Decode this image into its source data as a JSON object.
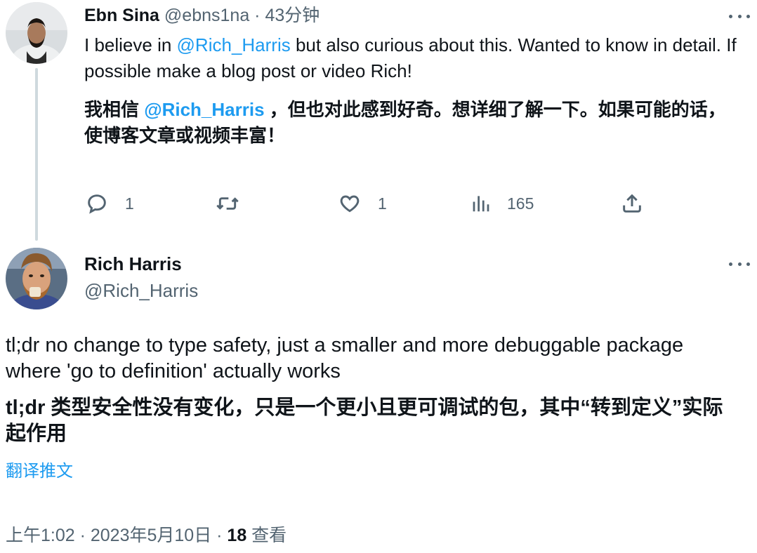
{
  "tweet1": {
    "author_name": "Ebn Sina",
    "handle": "@ebns1na",
    "separator": " · ",
    "time_ago": "43分钟",
    "text_before_mention": "I believe in ",
    "mention": "@Rich_Harris",
    "text_after_mention": " but also curious about this. Wanted to know in detail. If possible make a blog post or video Rich!",
    "translation_before_mention": "我相信 ",
    "translation_mention": "@Rich_Harris",
    "translation_after_mention": " ，但也对此感到好奇。想详细了解一下。如果可能的话，使博客文章或视频丰富！",
    "actions": {
      "reply_count": "1",
      "retweet_count": "",
      "like_count": "1",
      "views_count": "165"
    }
  },
  "tweet2": {
    "author_name": "Rich Harris",
    "handle": "@Rich_Harris",
    "text": "tl;dr no change to type safety, just a smaller and more debuggable package where 'go to definition' actually works",
    "translation": "tl;dr 类型安全性没有变化，只是一个更小且更可调试的包，其中“转到定义”实际起作用",
    "translate_link": "翻译推文",
    "timestamp": "上午1:02 · 2023年5月10日",
    "separator": " · ",
    "views_count": "18",
    "views_label": " 查看"
  },
  "colors": {
    "accent": "#1d9bf0",
    "secondary_text": "#536471",
    "primary_text": "#0f1419",
    "thread_line": "#cfd9de"
  },
  "icons": {
    "reply": "speech-bubble-icon",
    "retweet": "retweet-icon",
    "like": "heart-icon",
    "views": "bar-chart-icon",
    "share": "share-upload-icon",
    "more": "more-dots-icon"
  }
}
